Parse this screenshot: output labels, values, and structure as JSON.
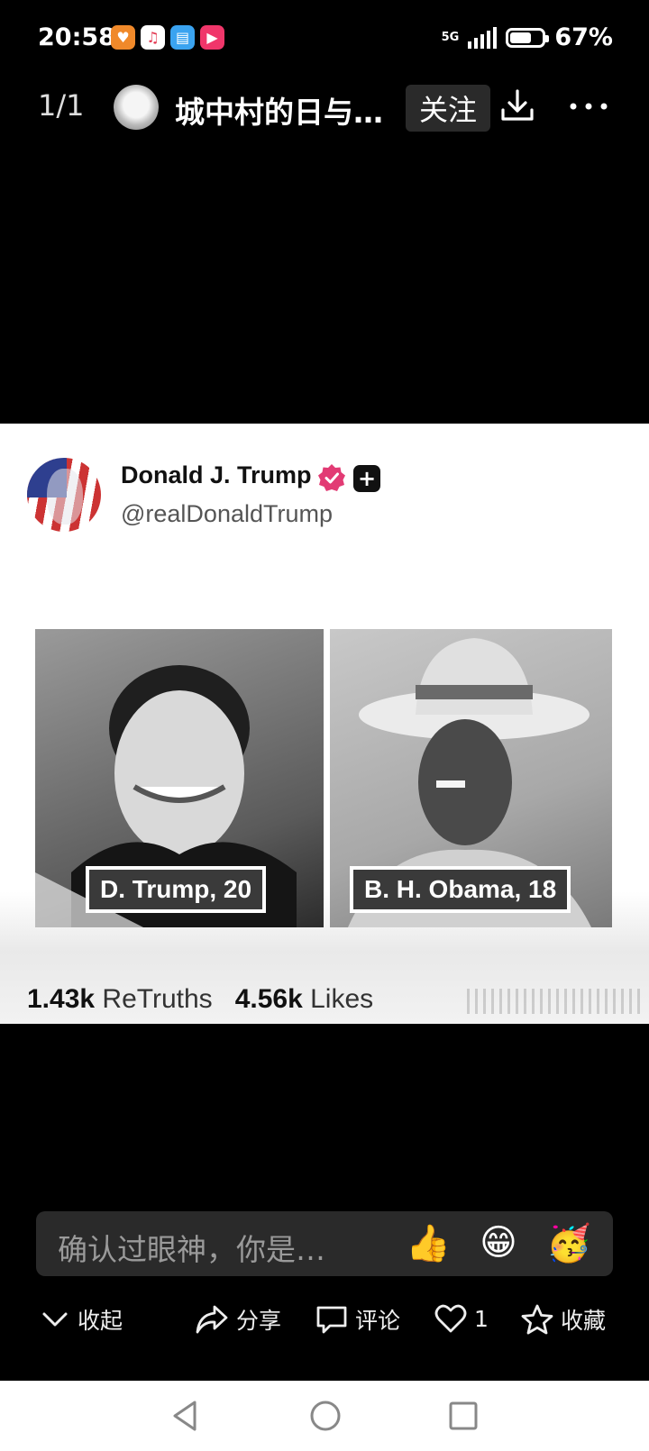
{
  "status_bar": {
    "time": "20:58",
    "network": "5G",
    "battery": "67%",
    "battery_level": 0.67,
    "app_icons": [
      "heart-app-icon",
      "music-app-icon",
      "book-app-icon",
      "video-app-icon"
    ]
  },
  "header": {
    "page_counter": "1/1",
    "title": "城中村的日与…",
    "follow_label": "关注"
  },
  "post": {
    "author_name": "Donald J. Trump",
    "author_handle": "@realDonaldTrump",
    "photos": [
      {
        "caption": "D. Trump, 20"
      },
      {
        "caption": "B. H. Obama, 18"
      }
    ],
    "retruths_count": "1.43k",
    "retruths_label": "ReTruths",
    "likes_count": "4.56k",
    "likes_label": "Likes"
  },
  "comment_bar": {
    "placeholder": "确认过眼神，你是…",
    "emojis": [
      "👍",
      "😁",
      "🥳"
    ]
  },
  "actions": {
    "collapse_label": "收起",
    "share_label": "分享",
    "comment_label": "评论",
    "like_count": "1",
    "favorite_label": "收藏"
  },
  "colors": {
    "verified_badge": "#e23b74",
    "background": "#000000",
    "card": "#ffffff"
  }
}
